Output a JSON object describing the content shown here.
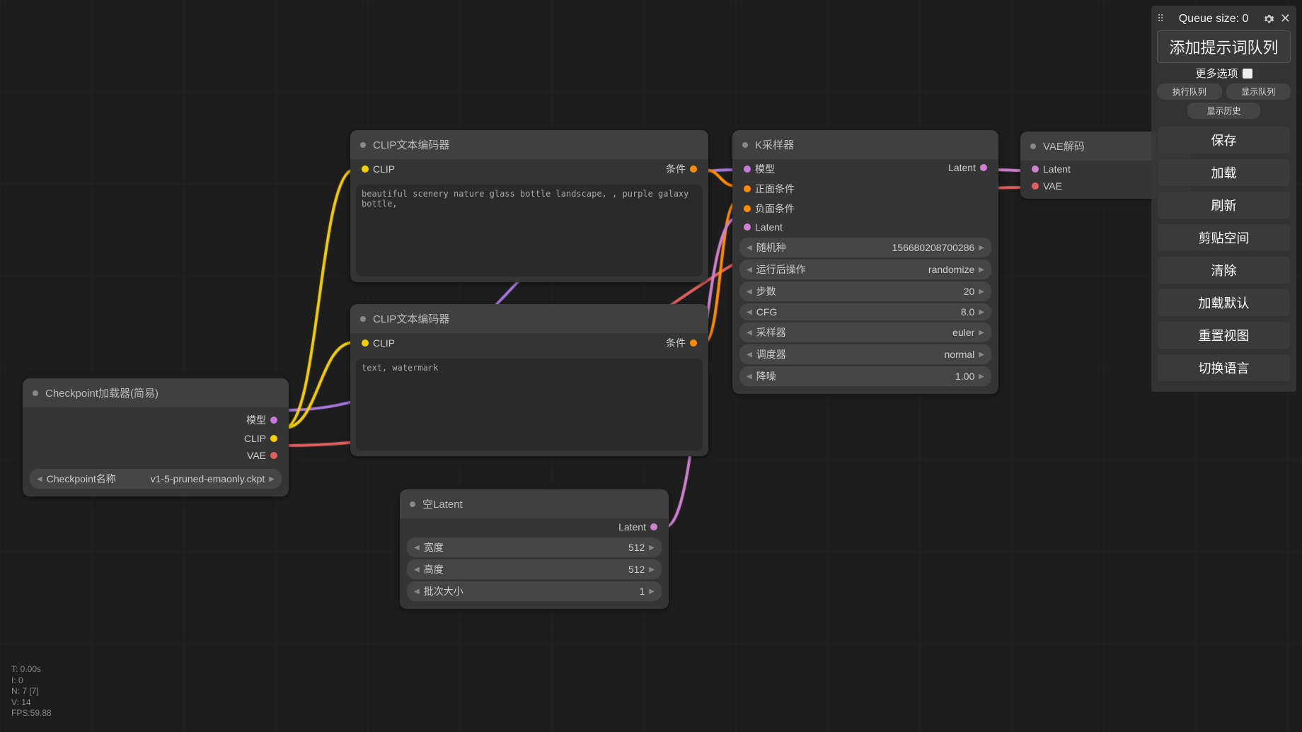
{
  "panel": {
    "queue_label": "Queue size: 0",
    "queue_main": "添加提示词队列",
    "more_options": "更多选项",
    "exec_queue": "执行队列",
    "show_queue": "显示队列",
    "show_history": "显示历史",
    "actions": [
      "保存",
      "加载",
      "刷新",
      "剪贴空间",
      "清除",
      "加载默认",
      "重置视图",
      "切换语言"
    ]
  },
  "nodes": {
    "checkpoint": {
      "title": "Checkpoint加载器(简易)",
      "outs": [
        "模型",
        "CLIP",
        "VAE"
      ],
      "widget": {
        "label": "Checkpoint名称",
        "value": "v1-5-pruned-emaonly.ckpt"
      }
    },
    "clip1": {
      "title": "CLIP文本编码器",
      "in": "CLIP",
      "out": "条件",
      "text": "beautiful scenery nature glass bottle landscape, , purple galaxy bottle,"
    },
    "clip2": {
      "title": "CLIP文本编码器",
      "in": "CLIP",
      "out": "条件",
      "text": "text, watermark"
    },
    "empty": {
      "title": "空Latent",
      "out": "Latent",
      "widgets": [
        {
          "label": "宽度",
          "value": "512"
        },
        {
          "label": "高度",
          "value": "512"
        },
        {
          "label": "批次大小",
          "value": "1"
        }
      ]
    },
    "ksampler": {
      "title": "K采样器",
      "ins": [
        "模型",
        "正面条件",
        "负面条件",
        "Latent"
      ],
      "out": "Latent",
      "widgets": [
        {
          "label": "随机种",
          "value": "156680208700286"
        },
        {
          "label": "运行后操作",
          "value": "randomize"
        },
        {
          "label": "步数",
          "value": "20"
        },
        {
          "label": "CFG",
          "value": "8.0"
        },
        {
          "label": "采样器",
          "value": "euler"
        },
        {
          "label": "调度器",
          "value": "normal"
        },
        {
          "label": "降噪",
          "value": "1.00"
        }
      ]
    },
    "vae": {
      "title": "VAE解码",
      "ins": [
        "Latent",
        "VAE"
      ]
    }
  },
  "stats": [
    "T: 0.00s",
    "I: 0",
    "N: 7 [7]",
    "V: 14",
    "FPS:59.88"
  ]
}
